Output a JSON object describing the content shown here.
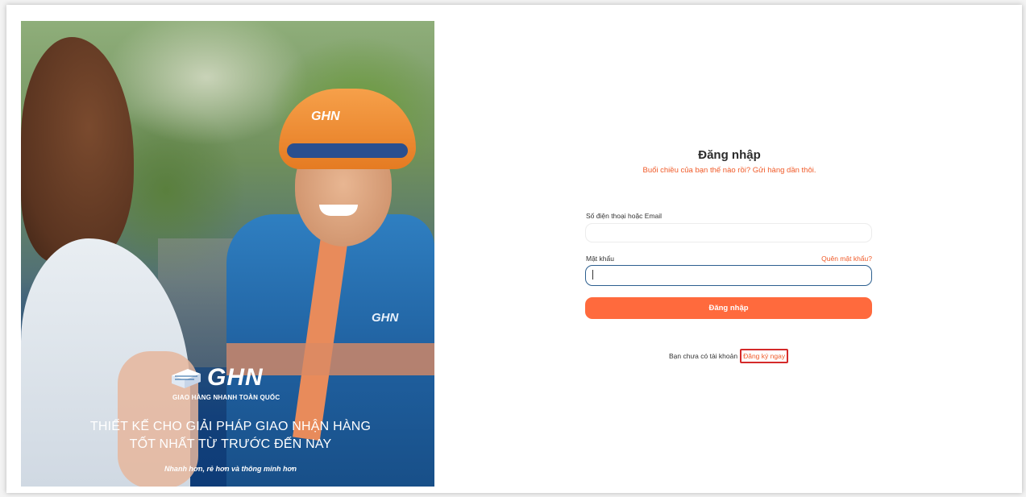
{
  "hero": {
    "helmet_logo": "GHN",
    "jacket_logo": "GHN",
    "brand_name": "GHN",
    "brand_tagline": "GIAO HÀNG NHANH TOÀN QUỐC",
    "headline_line1": "THIẾT KẾ CHO GIẢI PHÁP GIAO NHẬN HÀNG",
    "headline_line2": "TỐT NHẤT TỪ TRƯỚC ĐẾN NAY",
    "slogan": "Nhanh hơn, rẻ hơn và thông minh hơn"
  },
  "login": {
    "title": "Đăng nhập",
    "subtitle": "Buổi chiều của bạn thế nào rồi? Gửi hàng dần thôi.",
    "username_label": "Số điện thoại hoặc Email",
    "username_value": "",
    "password_label": "Mật khẩu",
    "password_value": "",
    "forgot_password": "Quên mật khẩu?",
    "submit_label": "Đăng nhập",
    "no_account_text": "Bạn chưa có tài khoản",
    "register_link": "Đăng ký ngay"
  },
  "colors": {
    "accent": "#ff6a3d",
    "link": "#f05a28",
    "highlight_box": "#d42a2a",
    "hero_blue": "#1f5f9e"
  }
}
